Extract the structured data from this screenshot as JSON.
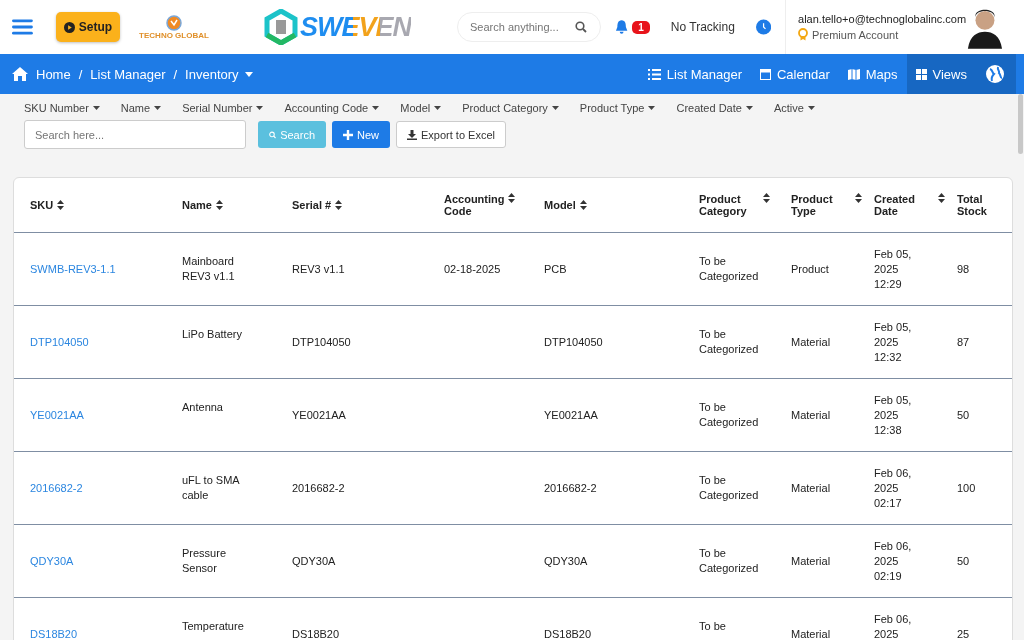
{
  "header": {
    "setup_button": "Setup",
    "company_logo": "TECHNO GLOBAL",
    "brand": "SWEVEN",
    "search": {
      "placeholder": "Search anything..."
    },
    "notifications": "1",
    "tracking": "No Tracking",
    "user": {
      "email": "alan.tello+o@technoglobalinc.com",
      "account": "Premium Account"
    }
  },
  "navbar": {
    "breadcrumbs": [
      {
        "label": "Home",
        "kind": "home"
      },
      {
        "label": "/",
        "kind": "separator"
      },
      {
        "label": "List Manager",
        "kind": "link"
      },
      {
        "label": "/",
        "kind": "separator"
      },
      {
        "label": "Inventory",
        "kind": "dropdown"
      }
    ],
    "menu": [
      {
        "label": "List Manager",
        "kind": "list",
        "selected": false
      },
      {
        "label": "Calendar",
        "kind": "calendar",
        "selected": false
      },
      {
        "label": "Maps",
        "kind": "map",
        "selected": false
      },
      {
        "label": "Views",
        "kind": "views",
        "selected": true
      }
    ]
  },
  "filters": [
    "SKU Number",
    "Name",
    "Serial Number",
    "Accounting Code",
    "Model",
    "Product Category",
    "Product Type",
    "Created Date",
    "Active"
  ],
  "search": {
    "placeholder": "Search here..."
  },
  "buttons": [
    {
      "label": "Search",
      "kind": "search"
    },
    {
      "label": "New",
      "kind": "new"
    },
    {
      "label": "Export to Excel",
      "kind": "export"
    }
  ],
  "table": {
    "columns": [
      "SKU",
      "Name",
      "Serial #",
      "Accounting Code",
      "Model",
      "Product Category",
      "Product Type",
      "Created Date",
      "Total Stock"
    ],
    "rows": [
      [
        "SWMB-REV3-1.1",
        "Mainboard REV3 v1.1",
        "REV3 v1.1",
        "02-18-2025",
        "PCB",
        "To be Categorized",
        "Product",
        "Feb 05, 2025 12:29",
        "98"
      ],
      [
        "DTP104050",
        "LiPo Battery",
        "DTP104050",
        "",
        "DTP104050",
        "To be Categorized",
        "Material",
        "Feb 05, 2025 12:32",
        "87"
      ],
      [
        "YE0021AA",
        "Antenna",
        "YE0021AA",
        "",
        "YE0021AA",
        "To be Categorized",
        "Material",
        "Feb 05, 2025 12:38",
        "50"
      ],
      [
        "2016682-2",
        "uFL to SMA cable",
        "2016682-2",
        "",
        "2016682-2",
        "To be Categorized",
        "Material",
        "Feb 06, 2025 02:17",
        "100"
      ],
      [
        "QDY30A",
        "Pressure Sensor",
        "QDY30A",
        "",
        "QDY30A",
        "To be Categorized",
        "Material",
        "Feb 06, 2025 02:19",
        "50"
      ],
      [
        "DS18B20",
        "Temperature",
        "DS18B20",
        "",
        "DS18B20",
        "To be",
        "Material",
        "Feb 06, 2025",
        "25"
      ]
    ]
  }
}
